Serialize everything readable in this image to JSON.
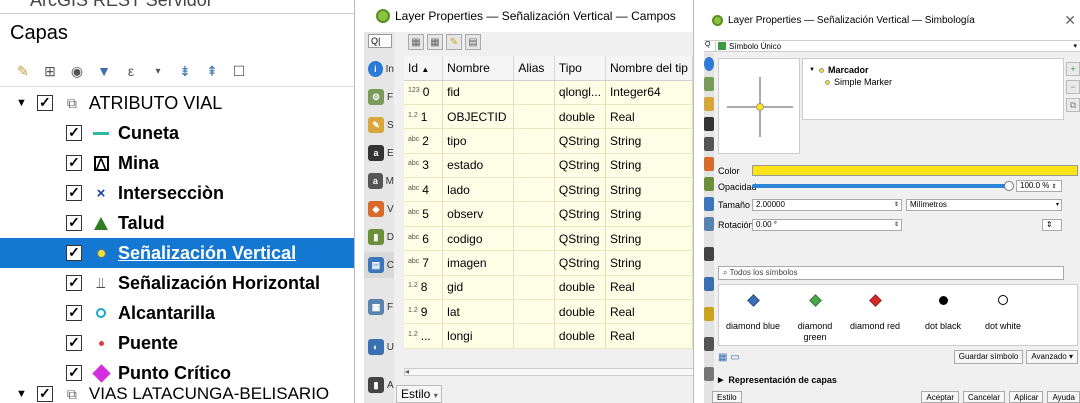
{
  "layers_panel": {
    "cut_top_text": "ArcGIS REST Servidor",
    "title": "Capas",
    "group_label": "ATRIBUTO VIAL",
    "layers": [
      {
        "label": "Cuneta",
        "icon": "line-icon",
        "color": "#2fb8a8"
      },
      {
        "label": "Mina",
        "icon": "mina-icon",
        "color": "#000000"
      },
      {
        "label": "Intersecciòn",
        "icon": "cross-icon",
        "color": "#1a3fa8"
      },
      {
        "label": "Talud",
        "icon": "triangle-icon",
        "color": "#2e7d1e"
      },
      {
        "label": "Señalización Vertical",
        "icon": "dot-icon",
        "color": "#e7e23c",
        "selected": true
      },
      {
        "label": "Señalización Horizontal",
        "icon": "pedestrian-line-icon",
        "color": "#333333"
      },
      {
        "label": "Alcantarilla",
        "icon": "circle-icon",
        "color": "#1aa7c9"
      },
      {
        "label": "Puente",
        "icon": "small-dot-icon",
        "color": "#e23b3b"
      },
      {
        "label": "Punto Crítico",
        "icon": "diamond-icon",
        "color": "#d32ee0"
      }
    ],
    "cut_bottom_text": "VIAS LATACUNGA-BELISARIO"
  },
  "fields_panel": {
    "window_title": "Layer Properties — Señalización Vertical — Campos",
    "columns": [
      "Id",
      "Nombre",
      "Alias",
      "Tipo",
      "Nombre del tip"
    ],
    "rows": [
      {
        "prefix": "123",
        "id": "0",
        "name": "fid",
        "alias": "",
        "type": "qlongl...",
        "type_name": "Integer64"
      },
      {
        "prefix": "1.2",
        "id": "1",
        "name": "OBJECTID",
        "alias": "",
        "type": "double",
        "type_name": "Real"
      },
      {
        "prefix": "abc",
        "id": "2",
        "name": "tipo",
        "alias": "",
        "type": "QString",
        "type_name": "String"
      },
      {
        "prefix": "abc",
        "id": "3",
        "name": "estado",
        "alias": "",
        "type": "QString",
        "type_name": "String"
      },
      {
        "prefix": "abc",
        "id": "4",
        "name": "lado",
        "alias": "",
        "type": "QString",
        "type_name": "String"
      },
      {
        "prefix": "abc",
        "id": "5",
        "name": "observ",
        "alias": "",
        "type": "QString",
        "type_name": "String"
      },
      {
        "prefix": "abc",
        "id": "6",
        "name": "codigo",
        "alias": "",
        "type": "QString",
        "type_name": "String"
      },
      {
        "prefix": "abc",
        "id": "7",
        "name": "imagen",
        "alias": "",
        "type": "QString",
        "type_name": "String"
      },
      {
        "prefix": "1.2",
        "id": "8",
        "name": "gid",
        "alias": "",
        "type": "double",
        "type_name": "Real"
      },
      {
        "prefix": "1.2",
        "id": "9",
        "name": "lat",
        "alias": "",
        "type": "double",
        "type_name": "Real"
      },
      {
        "prefix": "1.2",
        "id": "...",
        "name": "longi",
        "alias": "",
        "type": "double",
        "type_name": "Real"
      }
    ],
    "estilo_label": "Estilo"
  },
  "symbology_panel": {
    "window_title": "Layer Properties — Señalización Vertical — Simbología",
    "renderer": "Símbolo Único",
    "tree_root": "Marcador",
    "tree_child": "Simple Marker",
    "color_label": "Color",
    "color_value": "#fce417",
    "opacity_label": "Opacidad",
    "opacity_value": "100.0 %",
    "size_label": "Tamaño",
    "size_value": "2.00000",
    "size_unit": "Milímetros",
    "rotation_label": "Rotación",
    "rotation_value": "0.00 °",
    "search_placeholder": "Todos los símbolos",
    "symbols": [
      {
        "label": "diamond blue",
        "color": "#3b6fb6",
        "shape": "diamond"
      },
      {
        "label": "diamond green",
        "color": "#4aa64a",
        "shape": "diamond"
      },
      {
        "label": "diamond red",
        "color": "#d42a2a",
        "shape": "diamond"
      },
      {
        "label": "dot  black",
        "color": "#000000",
        "shape": "dot"
      },
      {
        "label": "dot  white",
        "color": "#ffffff",
        "shape": "ring"
      }
    ],
    "save_symbol": "Guardar símbolo",
    "advanced": "Avanzado",
    "layer_rendering": "Representación de capas",
    "footer_buttons": [
      "Estilo",
      "Aceptar",
      "Cancelar",
      "Aplicar",
      "Ayuda"
    ]
  }
}
